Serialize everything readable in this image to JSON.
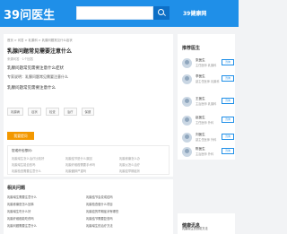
{
  "header": {
    "logo": "39问医生",
    "search_placeholder": "",
    "doctor_link": "39健康网"
  },
  "main": {
    "breadcrumb": "首页 > 问答 > 乳腺科 > 乳腺问题常见什么症状",
    "title": "乳腺问题常见需要注意什么",
    "meta": "来源问答 · 1个回答",
    "question": "乳腺问题常见需要注意什么症状",
    "answer": "专家说明：乳腺问题常见需要注意什么",
    "question2": "乳腺问题常见需要注意什么",
    "tags": [
      "乳腺病",
      "症状",
      "检查",
      "治疗",
      "保健"
    ],
    "ask_button": "我要提问",
    "recommend_title": "您或许也想问：",
    "recommend": [
      "乳腺增生怎么治疗比较好",
      "乳腺结节是什么原因",
      "乳腺疼痛怎么办",
      "乳腺增生能自愈吗",
      "乳腺纤维瘤需要手术吗",
      "乳腺炎怎么治疗",
      "乳腺检查需要注意什么",
      "乳腺囊肿严重吗",
      "乳腺癌早期症状"
    ]
  },
  "sidebar": {
    "title": "推荐医生",
    "doctors": [
      {
        "name": "张医生",
        "title": "主任医师 乳腺科"
      },
      {
        "name": "李医生",
        "title": "副主任医师 乳腺科"
      },
      {
        "name": "王医生",
        "title": "主治医师 乳腺科"
      },
      {
        "name": "赵医生",
        "title": "主任医师 外科"
      },
      {
        "name": "刘医生",
        "title": "副主任医师 外科"
      },
      {
        "name": "陈医生",
        "title": "主治医师 外科"
      }
    ],
    "consult_label": "咨询"
  },
  "related": {
    "title": "相关问题",
    "items": [
      "乳腺增生需要注意什么",
      "乳腺结节会变成癌吗",
      "乳腺疼痛是怎么回事",
      "乳腺检查做什么项目",
      "乳腺增生吃什么好",
      "乳腺癌的早期症状有哪些",
      "乳腺纤维瘤能吃药吗",
      "乳腺结节需要复查吗",
      "乳腺问题需要注意什么",
      "乳腺增生的治疗方法"
    ]
  },
  "sidebar2": {
    "title": "健康讯息",
    "items": [
      "乳腺增生的预防方法",
      "乳腺健康常识",
      "女性乳腺保健知识"
    ]
  }
}
